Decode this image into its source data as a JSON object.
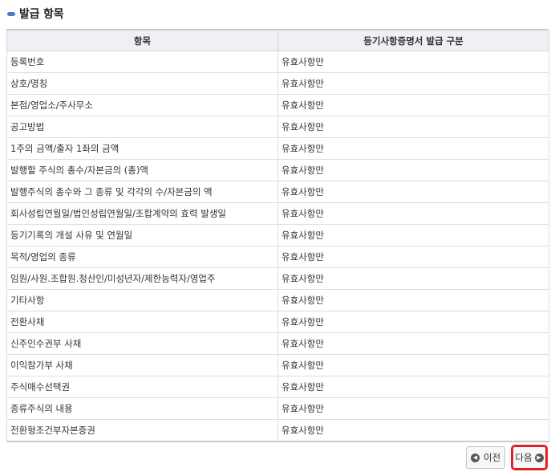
{
  "section": {
    "title": "발급 항목"
  },
  "table": {
    "headers": [
      "항목",
      "등기사항증명서 발급 구분"
    ],
    "rows": [
      {
        "item": "등록번호",
        "type": "유효사항만"
      },
      {
        "item": "상호/명칭",
        "type": "유효사항만"
      },
      {
        "item": "본점/영업소/주사무소",
        "type": "유효사항만"
      },
      {
        "item": "공고방법",
        "type": "유효사항만"
      },
      {
        "item": "1주의 금액/출자 1좌의 금액",
        "type": "유효사항만"
      },
      {
        "item": "발행할 주식의 총수/자본금의 (총)액",
        "type": "유효사항만"
      },
      {
        "item": "발행주식의 총수와 그 종류 및 각각의 수/자본금의 액",
        "type": "유효사항만"
      },
      {
        "item": "회사성립연월일/법인성립연월일/조합계약의 효력 발생일",
        "type": "유효사항만"
      },
      {
        "item": "등기기록의 개설 사유 및 연월일",
        "type": "유효사항만"
      },
      {
        "item": "목적/영업의 종류",
        "type": "유효사항만"
      },
      {
        "item": "임원/사원.조합원.청산인/미성년자/제한능력자/영업주",
        "type": "유효사항만"
      },
      {
        "item": "기타사항",
        "type": "유효사항만"
      },
      {
        "item": "전환사채",
        "type": "유효사항만"
      },
      {
        "item": "신주인수권부 사채",
        "type": "유효사항만"
      },
      {
        "item": "이익참가부 사채",
        "type": "유효사항만"
      },
      {
        "item": "주식매수선택권",
        "type": "유효사항만"
      },
      {
        "item": "종류주식의 내용",
        "type": "유효사항만"
      },
      {
        "item": "전환형조건부자본증권",
        "type": "유효사항만"
      }
    ]
  },
  "buttons": {
    "prev": {
      "label": "이전",
      "icon": "chevron-left-circle-icon"
    },
    "next": {
      "label": "다음",
      "icon": "chevron-right-circle-icon"
    }
  },
  "colors": {
    "accent": "#4a78c4",
    "header_bg": "#eef0f3",
    "highlight": "#e02020"
  }
}
